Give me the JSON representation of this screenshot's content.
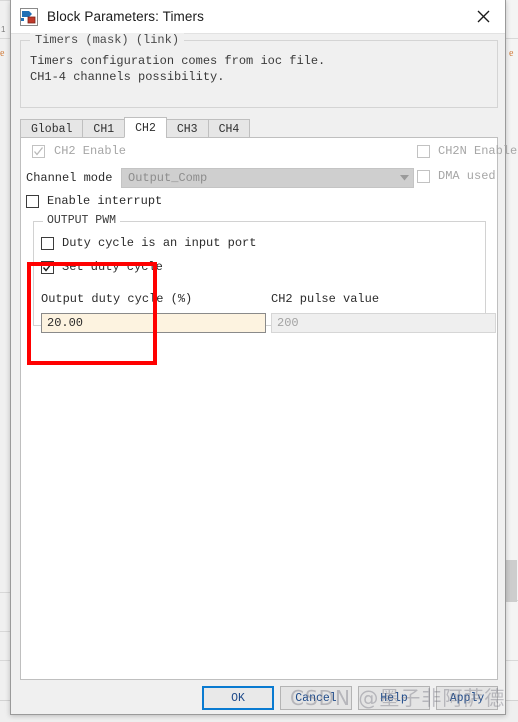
{
  "window": {
    "title": "Block Parameters: Timers",
    "icon": "simulink-block-icon",
    "close_label": "✕"
  },
  "mask": {
    "legend": "Timers (mask) (link)",
    "description": "Timers configuration comes from ioc file.\nCH1-4 channels possibility."
  },
  "tabs": [
    {
      "label": "Global",
      "active": false
    },
    {
      "label": "CH1",
      "active": false
    },
    {
      "label": "CH2",
      "active": true
    },
    {
      "label": "CH3",
      "active": false
    },
    {
      "label": "CH4",
      "active": false
    }
  ],
  "channel_panel": {
    "ch_enable": {
      "label": "CH2 Enable",
      "checked": true,
      "disabled": true
    },
    "chn_enable": {
      "label": "CH2N Enable",
      "checked": false,
      "disabled": true
    },
    "channel_mode": {
      "label": "Channel mode",
      "value": "Output_Comp",
      "disabled": true
    },
    "dma_used": {
      "label": "DMA used",
      "checked": false,
      "disabled": true
    },
    "enable_interrupt": {
      "label": "Enable interrupt",
      "checked": false,
      "disabled": false
    }
  },
  "pwm_group": {
    "legend": "OUTPUT PWM",
    "duty_input_port": {
      "label": "Duty cycle is an input port",
      "checked": false
    },
    "set_duty_cycle": {
      "label": "Set duty cycle",
      "checked": true
    },
    "duty_field": {
      "label": "Output duty cycle (%)",
      "value": "20.00",
      "readonly": false
    },
    "pulse_field": {
      "label": "CH2 pulse value",
      "value": "200",
      "readonly": true
    }
  },
  "annotation": {
    "highlight_color": "#ff0000"
  },
  "buttons": [
    {
      "label": "OK",
      "default": true
    },
    {
      "label": "Cancel",
      "default": false
    },
    {
      "label": "Help",
      "default": false
    },
    {
      "label": "Apply",
      "default": false
    }
  ],
  "watermark": {
    "text": "CSDN @墨子非阿萨德"
  },
  "backdrop": {
    "tick_label": "1",
    "edge_label": "e"
  }
}
